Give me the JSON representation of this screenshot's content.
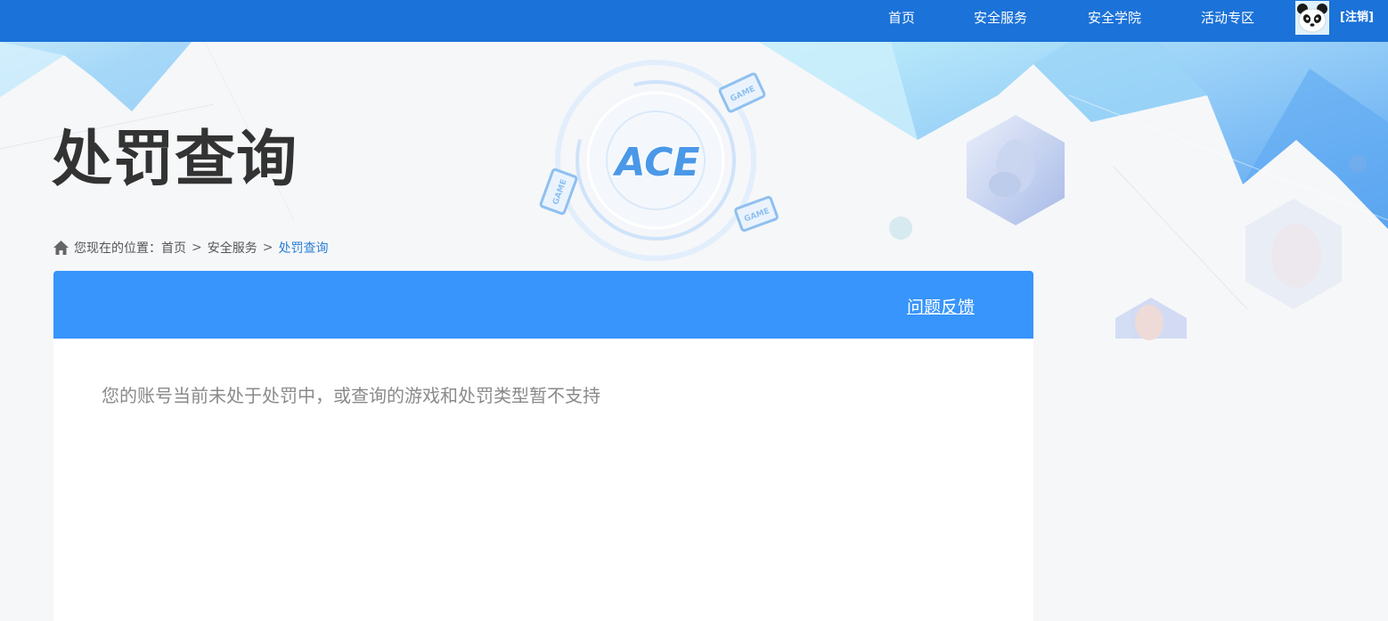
{
  "nav": {
    "items": [
      {
        "label": "首页"
      },
      {
        "label": "安全服务"
      },
      {
        "label": "安全学院"
      },
      {
        "label": "活动专区"
      }
    ],
    "logout_label": "[注销]"
  },
  "banner": {
    "logo_text": "ACE",
    "game_badge": "GAME"
  },
  "page": {
    "title": "处罚查询"
  },
  "breadcrumb": {
    "prefix": "您现在的位置：",
    "items": [
      "首页",
      "安全服务",
      "处罚查询"
    ],
    "separator": ">"
  },
  "panel": {
    "feedback_label": "问题反馈",
    "message": "您的账号当前未处于处罚中，或查询的游戏和处罚类型暂不支持"
  },
  "colors": {
    "topbar": "#1b72d8",
    "panel_header": "#3895fc",
    "link_current": "#2a7fd6"
  },
  "icons": [
    "home-icon",
    "panda-avatar-icon",
    "ace-logo-icon",
    "game-badge-icon"
  ]
}
